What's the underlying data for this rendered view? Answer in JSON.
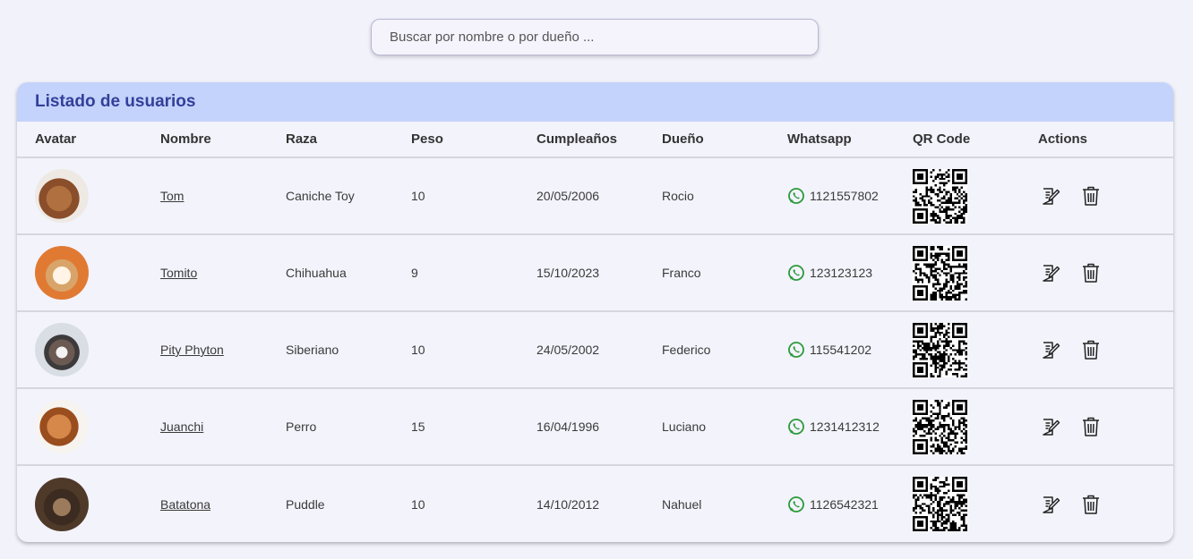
{
  "search": {
    "placeholder": "Buscar por nombre o por dueño ..."
  },
  "table": {
    "title": "Listado de usuarios",
    "columns": [
      "Avatar",
      "Nombre",
      "Raza",
      "Peso",
      "Cumpleaños",
      "Dueño",
      "Whatsapp",
      "QR Code",
      "Actions"
    ],
    "rows": [
      {
        "nombre": "Tom",
        "raza": "Caniche Toy",
        "peso": "10",
        "cumpleanos": "20/05/2006",
        "dueno": "Rocio",
        "whatsapp": "1121557802"
      },
      {
        "nombre": "Tomito",
        "raza": "Chihuahua",
        "peso": "9",
        "cumpleanos": "15/10/2023",
        "dueno": "Franco",
        "whatsapp": "123123123"
      },
      {
        "nombre": "Pity Phyton",
        "raza": "Siberiano",
        "peso": "10",
        "cumpleanos": "24/05/2002",
        "dueno": "Federico",
        "whatsapp": "115541202"
      },
      {
        "nombre": "Juanchi",
        "raza": "Perro",
        "peso": "15",
        "cumpleanos": "16/04/1996",
        "dueno": "Luciano",
        "whatsapp": "1231412312"
      },
      {
        "nombre": "Batatona",
        "raza": "Puddle",
        "peso": "10",
        "cumpleanos": "14/10/2012",
        "dueno": "Nahuel",
        "whatsapp": "1126542321"
      }
    ]
  },
  "icons": {
    "whatsapp": "whatsapp-icon",
    "edit": "edit-icon",
    "delete": "trash-icon"
  },
  "colors": {
    "header_bg": "#c4d3fb",
    "title": "#33409a",
    "whatsapp": "#2b9a3a"
  }
}
